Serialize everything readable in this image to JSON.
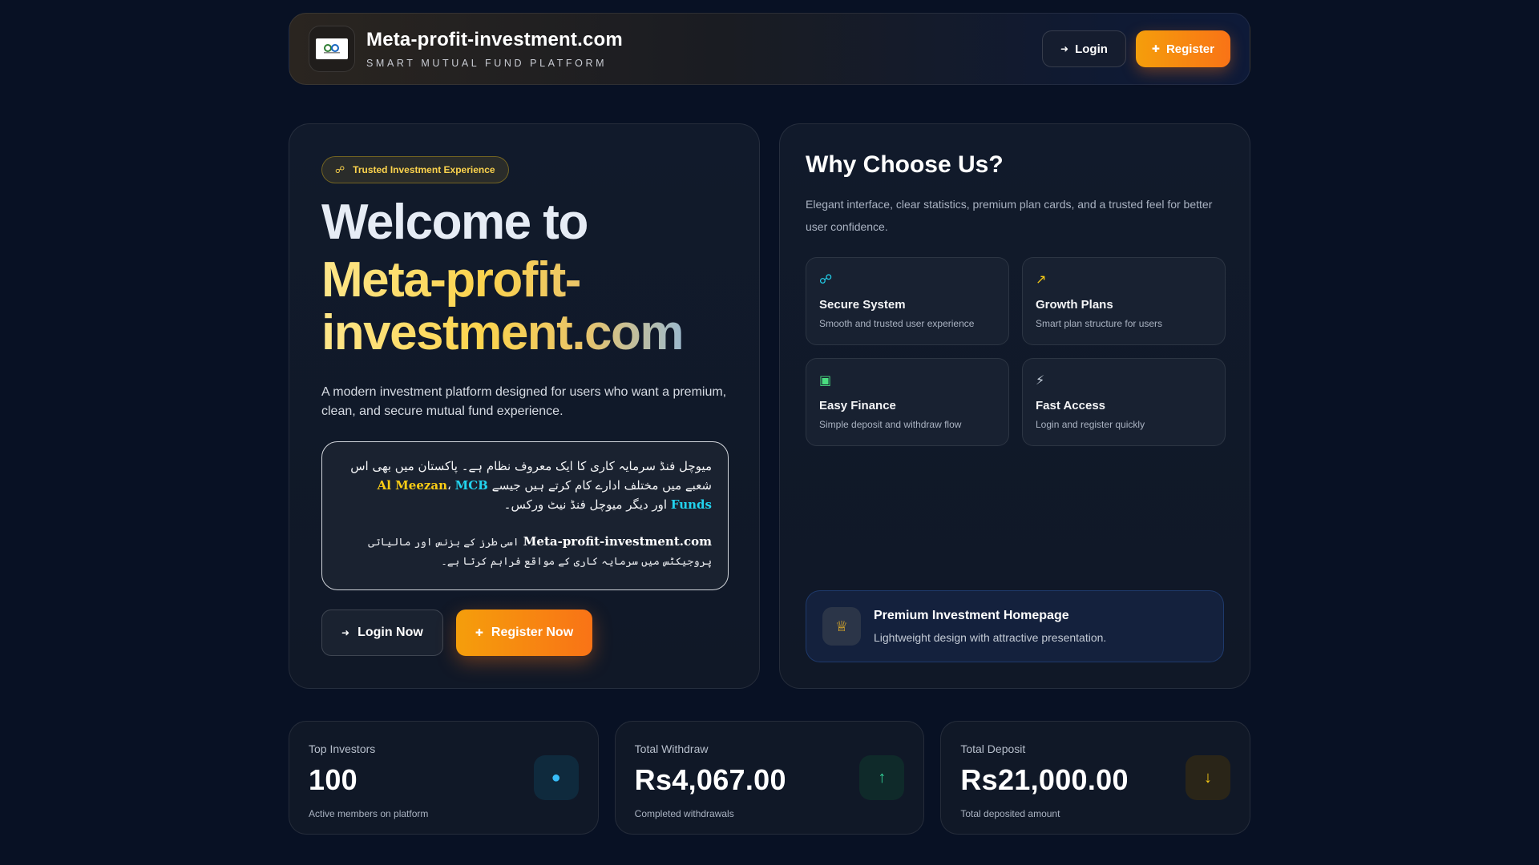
{
  "header": {
    "title": "Meta-profit-investment.com",
    "subtitle": "SMART MUTUAL FUND PLATFORM",
    "login_label": "Login",
    "register_label": "Register",
    "login_icon": "sign-in-icon",
    "register_icon": "user-plus-icon"
  },
  "hero": {
    "badge": "Trusted Investment Experience",
    "badge_icon": "shield-icon",
    "heading_line1": "Welcome to",
    "heading_line2": "Meta-profit-investment.com",
    "description": "A modern investment platform designed for users who want a premium, clean, and secure mutual fund experience.",
    "urdu": {
      "p1_text": "میوچل فنڈ سرمایہ کاری کا ایک معروف نظام ہے۔ پاکستان میں بھی اس شعبے میں مختلف ادارے کام کرتے ہیں جیسے",
      "p1_highlight1": "Al Meezan",
      "p1_sep": "،",
      "p1_highlight2": "MCB Funds",
      "p1_tail": "اور دیگر میوچل فنڈ نیٹ ورکس۔",
      "p2_brand": "Meta-profit-investment.com",
      "p2_text": "اسی طرز کے بزنس اور مالیاتی پروجیکٹس میں سرمایہ کاری کے مواقع فراہم کرتا ہے۔"
    },
    "login_label": "Login Now",
    "register_label": "Register Now"
  },
  "why": {
    "title": "Why Choose Us?",
    "description": "Elegant interface, clear statistics, premium plan cards, and a trusted feel for better user confidence.",
    "features": [
      {
        "title": "Secure System",
        "text": "Smooth and trusted user experience",
        "icon": "shield-icon",
        "color": "#22d3ee"
      },
      {
        "title": "Growth Plans",
        "text": "Smart plan structure for users",
        "icon": "chart-line-icon",
        "color": "#facc15"
      },
      {
        "title": "Easy Finance",
        "text": "Simple deposit and withdraw flow",
        "icon": "wallet-icon",
        "color": "#4ade80"
      },
      {
        "title": "Fast Access",
        "text": "Login and register quickly",
        "icon": "bolt-icon",
        "color": "#cbd5e1"
      }
    ],
    "promo": {
      "title": "Premium Investment Homepage",
      "subtitle": "Lightweight design with attractive presentation.",
      "icon": "crown-icon"
    }
  },
  "stats": [
    {
      "label": "Top Investors",
      "value": "100",
      "sub": "Active members on platform",
      "icon": "users-icon",
      "color": "#38bdf8",
      "bg": "#0f2a3d"
    },
    {
      "label": "Total Withdraw",
      "value": "Rs4,067.00",
      "sub": "Completed withdrawals",
      "icon": "money-out-icon",
      "color": "#34d399",
      "bg": "#0f2a2a"
    },
    {
      "label": "Total Deposit",
      "value": "Rs21,000.00",
      "sub": "Total deposited amount",
      "icon": "money-in-icon",
      "color": "#facc15",
      "bg": "#2a2518"
    }
  ]
}
